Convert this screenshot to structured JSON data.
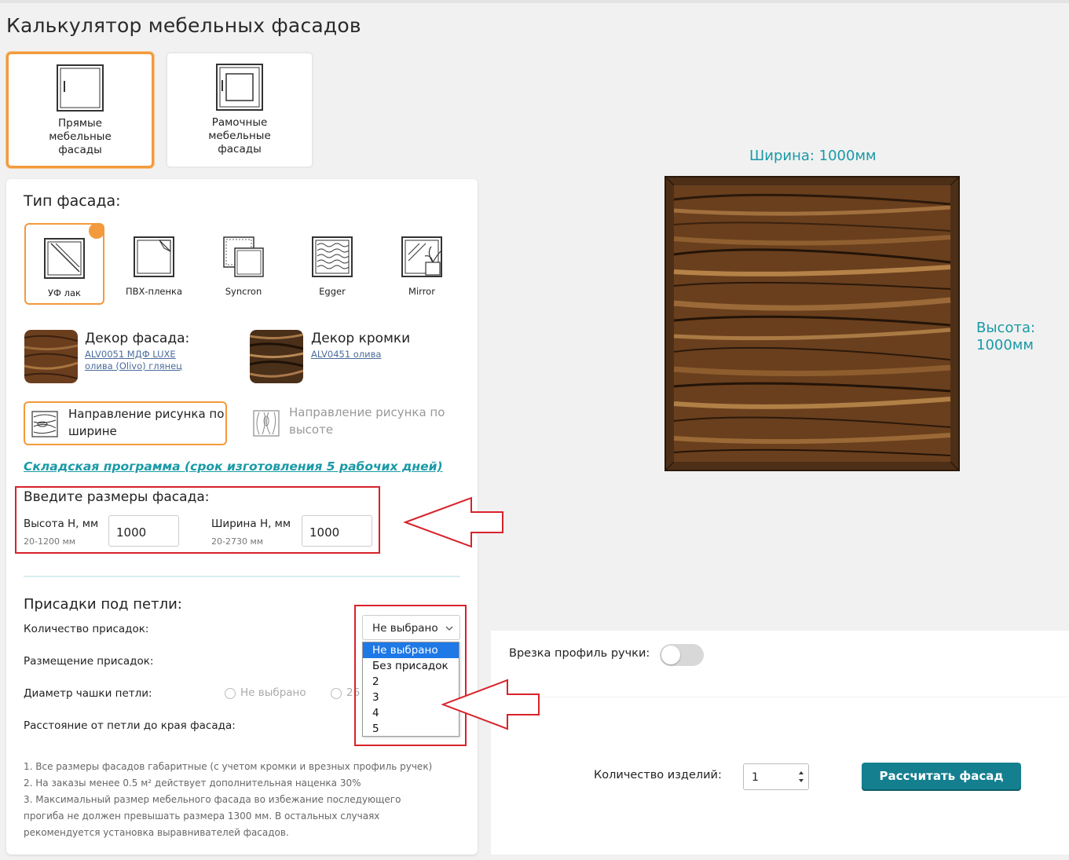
{
  "page": {
    "title": "Калькулятор мебельных фасадов"
  },
  "type_cards": [
    {
      "label_lines": [
        "Прямые",
        "мебельные",
        "фасады"
      ],
      "selected": true
    },
    {
      "label_lines": [
        "Рамочные",
        "мебельные",
        "фасады"
      ],
      "selected": false
    }
  ],
  "facade_type": {
    "title": "Тип фасада:",
    "options": [
      {
        "label": "УФ лак",
        "icon": "uv-lacquer-icon",
        "selected": true
      },
      {
        "label": "ПВХ-пленка",
        "icon": "pvc-film-icon",
        "selected": false
      },
      {
        "label": "Syncron",
        "icon": "syncron-icon",
        "selected": false
      },
      {
        "label": "Egger",
        "icon": "egger-icon",
        "selected": false
      },
      {
        "label": "Mirror",
        "icon": "mirror-icon",
        "selected": false
      }
    ]
  },
  "decor_facade": {
    "title": "Декор фасада:",
    "link_line1": "ALV0051 МДФ LUXE",
    "link_line2": "олива (Olivo) глянец"
  },
  "decor_edge": {
    "title": "Декор кромки",
    "link": "ALV0451 олива"
  },
  "direction": {
    "width": {
      "line1": "Направление рисунка по",
      "line2": "ширине",
      "selected": true
    },
    "height": {
      "line1": "Направление рисунка по",
      "line2": "высоте",
      "selected": false
    }
  },
  "stock_program": "Складская программа (срок изготовления 5 рабочих дней)",
  "dimensions": {
    "title": "Введите размеры фасада:",
    "height": {
      "label": "Высота Н, мм",
      "range": "20-1200 мм",
      "value": "1000"
    },
    "width": {
      "label": "Ширина Н, мм",
      "range": "20-2730 мм",
      "value": "1000"
    }
  },
  "hinges": {
    "title": "Присадки под петли:",
    "count_label": "Количество присадок:",
    "placement_label": "Размещение присадок:",
    "diameter_label": "Диаметр чашки петли:",
    "distance_label": "Расстояние от петли до края фасада:",
    "select_value": "Не выбрано",
    "options": [
      "Не выбрано",
      "Без присадок",
      "2",
      "3",
      "4",
      "5"
    ],
    "diameter_option1": "Не выбрано",
    "diameter_option2": "26"
  },
  "notes": [
    "1. Все размеры фасадов габаритные (с учетом кромки и врезных профиль ручек)",
    "2. На заказы менее 0.5 м² действует дополнительная наценка 30%",
    "3. Максимальный размер мебельного фасада во избежание последующего",
    "прогиба не должен превышать размера 1300 мм. В остальных случаях",
    "рекомендуется установка выравнивателей фасадов."
  ],
  "preview": {
    "width_label": "Ширина: 1000мм",
    "height_line1": "Высота:",
    "height_line2": "1000мм"
  },
  "handle": {
    "label": "Врезка профиль ручки:",
    "enabled": false
  },
  "order": {
    "qty_label": "Количество изделий:",
    "qty_value": "1",
    "button": "Рассчитать фасад"
  },
  "colors": {
    "accent": "#f29a3c",
    "teal": "#1a9aa6",
    "button": "#147f8f",
    "highlight": "#d8222a"
  }
}
